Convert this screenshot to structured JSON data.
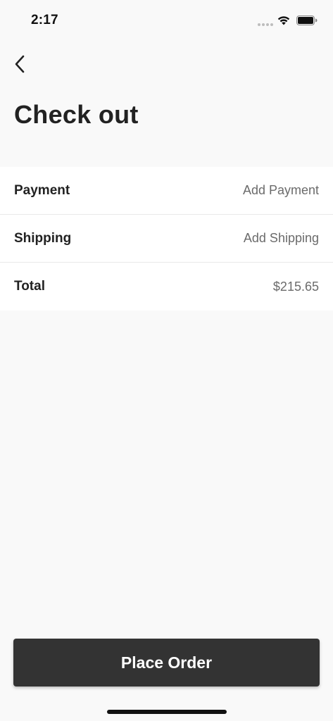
{
  "status_bar": {
    "time": "2:17"
  },
  "header": {
    "back_icon": "chevron-left-icon",
    "title": "Check out"
  },
  "rows": [
    {
      "label": "Payment",
      "value": "Add Payment"
    },
    {
      "label": "Shipping",
      "value": "Add Shipping"
    },
    {
      "label": "Total",
      "value": "$215.65"
    }
  ],
  "footer": {
    "place_order_label": "Place Order"
  },
  "colors": {
    "background": "#f9f9f9",
    "button": "#333333",
    "value_text": "#6b6b6b"
  }
}
